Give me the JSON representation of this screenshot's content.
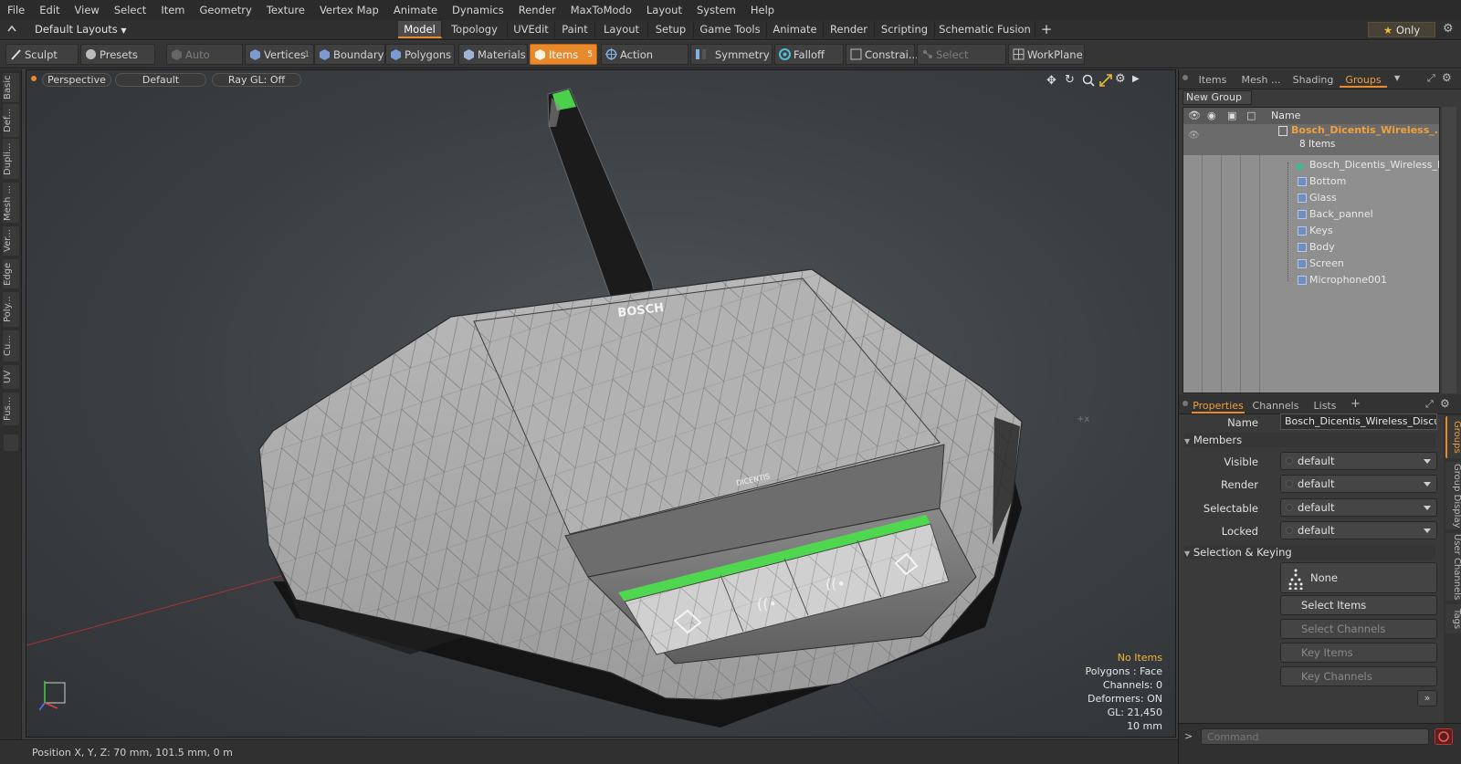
{
  "menu": [
    "File",
    "Edit",
    "View",
    "Select",
    "Item",
    "Geometry",
    "Texture",
    "Vertex Map",
    "Animate",
    "Dynamics",
    "Render",
    "MaxToModo",
    "Layout",
    "System",
    "Help"
  ],
  "layout_selector": "Default Layouts",
  "layout_tabs": [
    {
      "label": "Model",
      "active": true
    },
    {
      "label": "Topology"
    },
    {
      "label": "UVEdit"
    },
    {
      "label": "Paint"
    },
    {
      "label": "Layout"
    },
    {
      "label": "Setup"
    },
    {
      "label": "Game Tools"
    },
    {
      "label": "Animate"
    },
    {
      "label": "Render"
    },
    {
      "label": "Scripting"
    },
    {
      "label": "Schematic Fusion"
    }
  ],
  "only_label": "Only",
  "toolbar": {
    "sculpt": "Sculpt",
    "presets": "Presets",
    "auto_select": "Auto Select",
    "vertices": "Vertices",
    "vertices_count": "1",
    "boundary": "Boundary",
    "polygons": "Polygons",
    "materials": "Materials",
    "items": "Items",
    "items_count": "5",
    "action_center": "Action Center",
    "symmetry": "Symmetry",
    "falloff": "Falloff",
    "constraints": "Constrai...",
    "select_through": "Select Through",
    "workplane": "WorkPlane"
  },
  "left_tabs": [
    "Basic",
    "Def...",
    "Dupli...",
    "Mesh ...",
    "Ver...",
    "Edge",
    "Poly...",
    "Cu...",
    "UV",
    "Fus..."
  ],
  "viewport": {
    "view": "Perspective",
    "shading": "Default",
    "raygl": "Ray GL: Off",
    "product_brand": "BOSCH",
    "product_sub": "DICENTIS",
    "info": {
      "selection": "No Items",
      "polygons": "Polygons : Face",
      "channels": "Channels: 0",
      "deformers": "Deformers: ON",
      "gl": "GL: 21,450",
      "scale": "10 mm"
    }
  },
  "status": "Position X, Y, Z:  70 mm, 101.5 mm, 0 m",
  "right_panel": {
    "top_tabs": [
      {
        "label": "Items"
      },
      {
        "label": "Mesh ..."
      },
      {
        "label": "Shading"
      },
      {
        "label": "Groups",
        "active": true
      }
    ],
    "new_group": "New Group",
    "name_header": "Name",
    "group_name": "Bosch_Dicentis_Wireless_...",
    "group_count": "8 Items",
    "items": [
      "Bosch_Dicentis_Wireless_Di ...",
      "Bottom",
      "Glass",
      "Back_pannel",
      "Keys",
      "Body",
      "Screen",
      "Microphone001"
    ],
    "prop_tabs": [
      {
        "label": "Properties",
        "active": true
      },
      {
        "label": "Channels"
      },
      {
        "label": "Lists"
      }
    ],
    "name_label": "Name",
    "name_value": "Bosch_Dicentis_Wireless_Discussi",
    "members_label": "Members",
    "fields": [
      {
        "label": "Visible",
        "value": "default"
      },
      {
        "label": "Render",
        "value": "default"
      },
      {
        "label": "Selectable",
        "value": "default"
      },
      {
        "label": "Locked",
        "value": "default"
      }
    ],
    "sel_keying_label": "Selection & Keying",
    "none_label": "None",
    "select_items": "Select Items",
    "select_channels": "Select Channels",
    "key_items": "Key Items",
    "key_channels": "Key Channels",
    "side_tabs": [
      "Groups",
      "Group Display",
      "User Channels",
      "Tags"
    ],
    "command_placeholder": "Command"
  }
}
